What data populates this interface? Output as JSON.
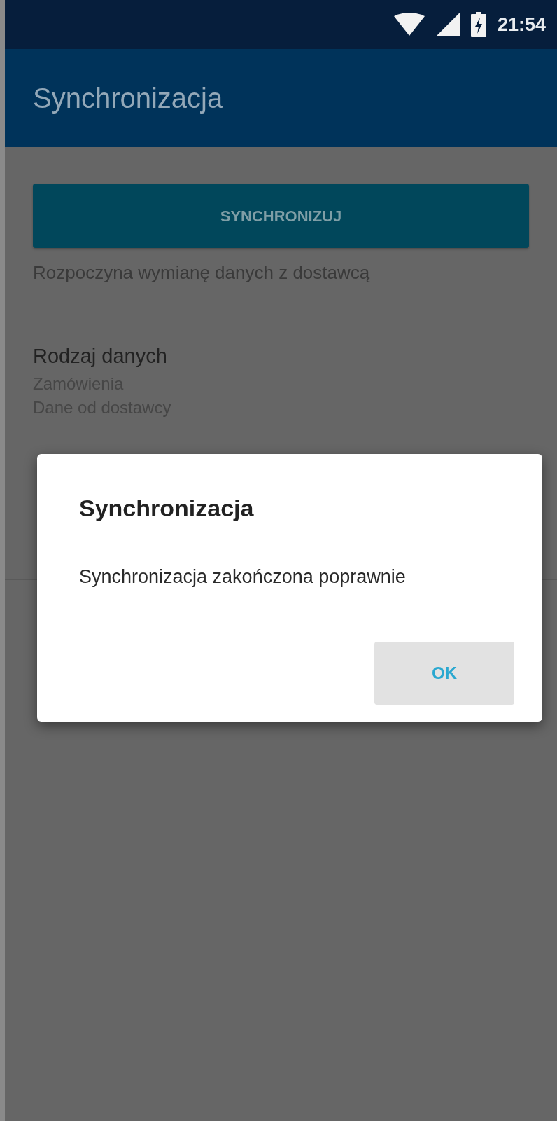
{
  "status_bar": {
    "time": "21:54"
  },
  "app_bar": {
    "title": "Synchronizacja"
  },
  "sync_button": {
    "label": "SYNCHRONIZUJ"
  },
  "sync_description": "Rozpoczyna wymianę danych z dostawcą",
  "data_type": {
    "title": "Rodzaj danych",
    "lines": [
      "Zamówienia",
      "Dane od dostawcy"
    ]
  },
  "dialog": {
    "title": "Synchronizacja",
    "message": "Synchronizacja zakończona poprawnie",
    "buttons": [
      "OK"
    ]
  }
}
